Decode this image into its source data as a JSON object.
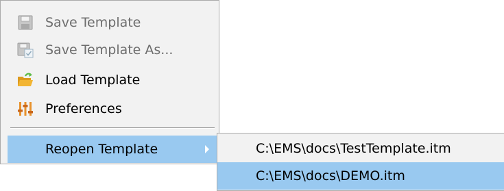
{
  "menu": {
    "items": [
      {
        "label": "Save Template",
        "icon": "save-icon",
        "enabled": false
      },
      {
        "label": "Save Template As...",
        "icon": "save-as-icon",
        "enabled": false
      },
      {
        "label": "Load Template",
        "icon": "folder-open-icon",
        "enabled": true
      },
      {
        "label": "Preferences",
        "icon": "preferences-icon",
        "enabled": true
      }
    ],
    "reopen": {
      "label": "Reopen Template",
      "highlighted": true
    }
  },
  "submenu": {
    "items": [
      {
        "label": "C:\\EMS\\docs\\TestTemplate.itm",
        "highlighted": false
      },
      {
        "label": "C:\\EMS\\docs\\DEMO.itm",
        "highlighted": true
      }
    ]
  },
  "colors": {
    "menu_bg": "#f2f2f2",
    "highlight": "#99c9f0",
    "disabled_text": "#6d6d6d",
    "folder": "#f2b533",
    "arrow_green": "#5dbb46",
    "prefs_orange": "#e8922c"
  }
}
